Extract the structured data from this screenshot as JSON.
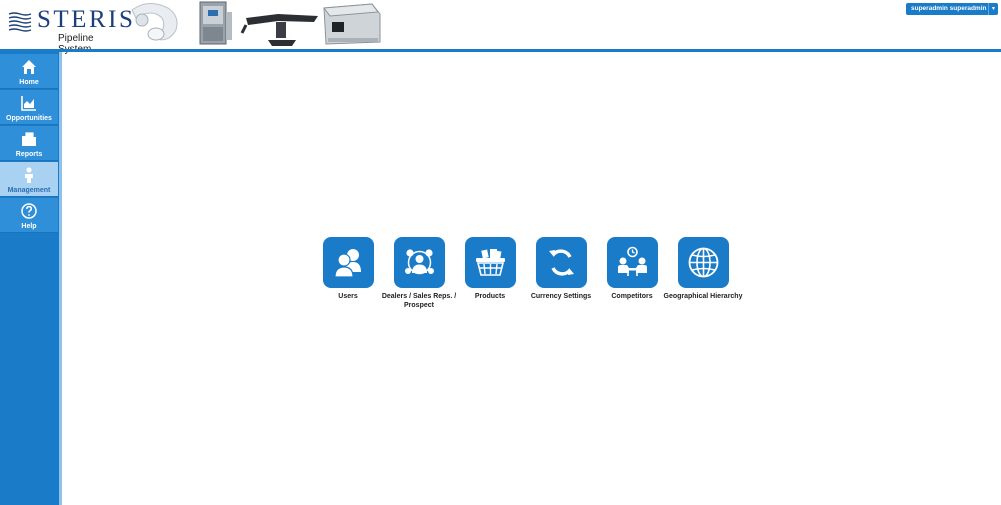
{
  "header": {
    "brand": "STERIS",
    "subtitle": "Pipeline System",
    "user_menu_label": "superadmin superadmin",
    "user_menu_caret": "▼"
  },
  "sidebar": {
    "items": [
      {
        "label": "Home",
        "icon": "home-icon"
      },
      {
        "label": "Opportunities",
        "icon": "chart-icon"
      },
      {
        "label": "Reports",
        "icon": "folder-icon"
      },
      {
        "label": "Management",
        "icon": "person-icon",
        "active": true
      },
      {
        "label": "Help",
        "icon": "help-icon"
      }
    ]
  },
  "tiles": [
    {
      "label": "Users",
      "icon": "users-icon"
    },
    {
      "label": "Dealers / Sales Reps. / Prospect",
      "icon": "network-icon"
    },
    {
      "label": "Products",
      "icon": "basket-icon"
    },
    {
      "label": "Currency Settings",
      "icon": "refresh-icon"
    },
    {
      "label": "Competitors",
      "icon": "competitors-icon"
    },
    {
      "label": "Geographical Hierarchy",
      "icon": "globe-icon"
    }
  ],
  "colors": {
    "accent": "#1a7cc8",
    "sidebar_item": "#2f8fd8",
    "sidebar_active": "#a9d1f1"
  }
}
